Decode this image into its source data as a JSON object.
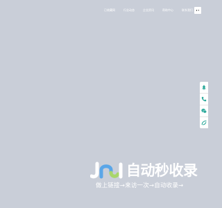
{
  "nav": {
    "items": [
      {
        "label": "已收藏网"
      },
      {
        "label": "行业动态"
      },
      {
        "label": "企业资讯"
      },
      {
        "label": "帮助中心"
      },
      {
        "label": "联系我们"
      }
    ],
    "lang_icon": "globe-dropdown-icon"
  },
  "float_bar": {
    "items": [
      {
        "icon": "tree-icon"
      },
      {
        "icon": "phone-icon"
      },
      {
        "icon": "wechat-icon"
      },
      {
        "icon": "link-icon"
      }
    ],
    "accent": "#2aa89a"
  },
  "watermark": {
    "title": "自动秒收录",
    "subtitle": "做上链接→来访一次→自动收录→"
  }
}
